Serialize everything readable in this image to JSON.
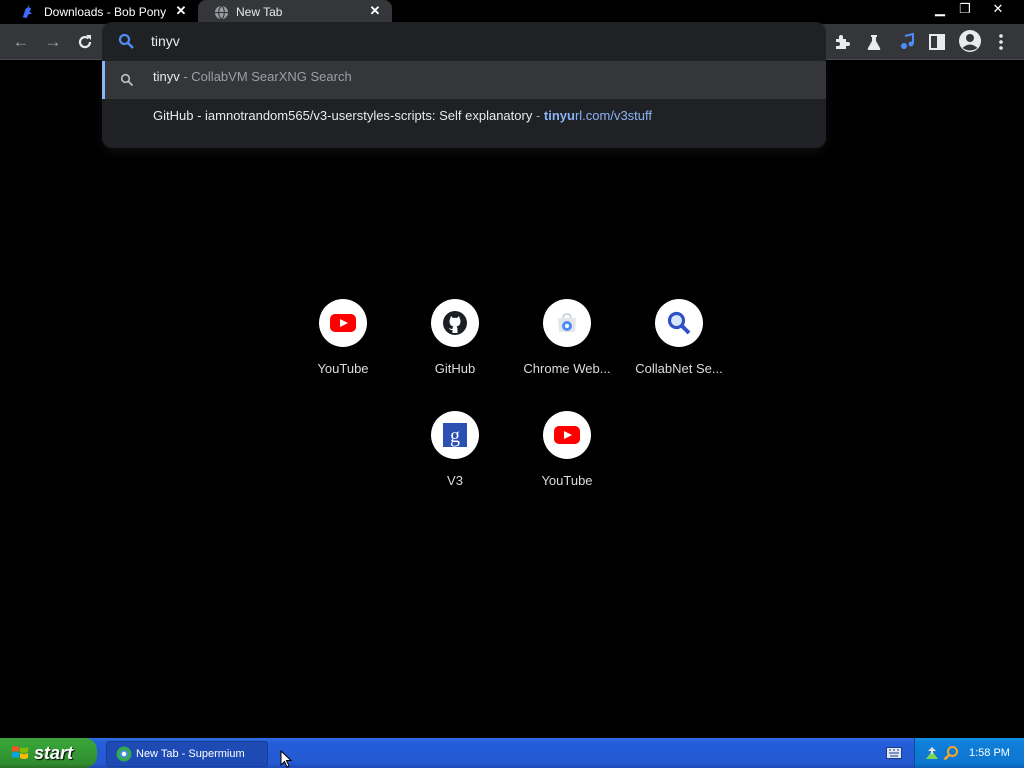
{
  "tabs": [
    {
      "title": "Downloads - Bob Pony",
      "icon": "bob-pony-icon",
      "active": false
    },
    {
      "title": "New Tab",
      "icon": "globe-icon",
      "active": true
    }
  ],
  "omnibox": {
    "value": "tinyv",
    "placeholder": ""
  },
  "suggestions": [
    {
      "query": "tinyv",
      "separator": " - ",
      "source": "CollabVM SearXNG Search",
      "icon": "search-icon"
    },
    {
      "title": "GitHub - iamnotrandom565/v3-userstyles-scripts: Self explanatory",
      "separator": " - ",
      "url_bold": "tinyu",
      "url_rest": "rl.com/v3stuff",
      "icon": "blank-icon"
    }
  ],
  "shortcuts": [
    {
      "label": "YouTube",
      "icon": "youtube-icon"
    },
    {
      "label": "GitHub",
      "icon": "github-icon"
    },
    {
      "label": "Chrome Web...",
      "icon": "chrome-web-store-icon"
    },
    {
      "label": "CollabNet Se...",
      "icon": "magnifier-icon"
    },
    {
      "label": "V3",
      "icon": "google-g-icon"
    },
    {
      "label": "YouTube",
      "icon": "youtube-icon"
    }
  ],
  "taskbar": {
    "start_label": "start",
    "window_label": "New Tab - Supermium",
    "clock": "1:58 PM"
  },
  "colors": {
    "accent": "#8ab4f8",
    "youtube": "#ff0000",
    "xp_blue": "#245edb",
    "xp_green": "#37a337"
  }
}
